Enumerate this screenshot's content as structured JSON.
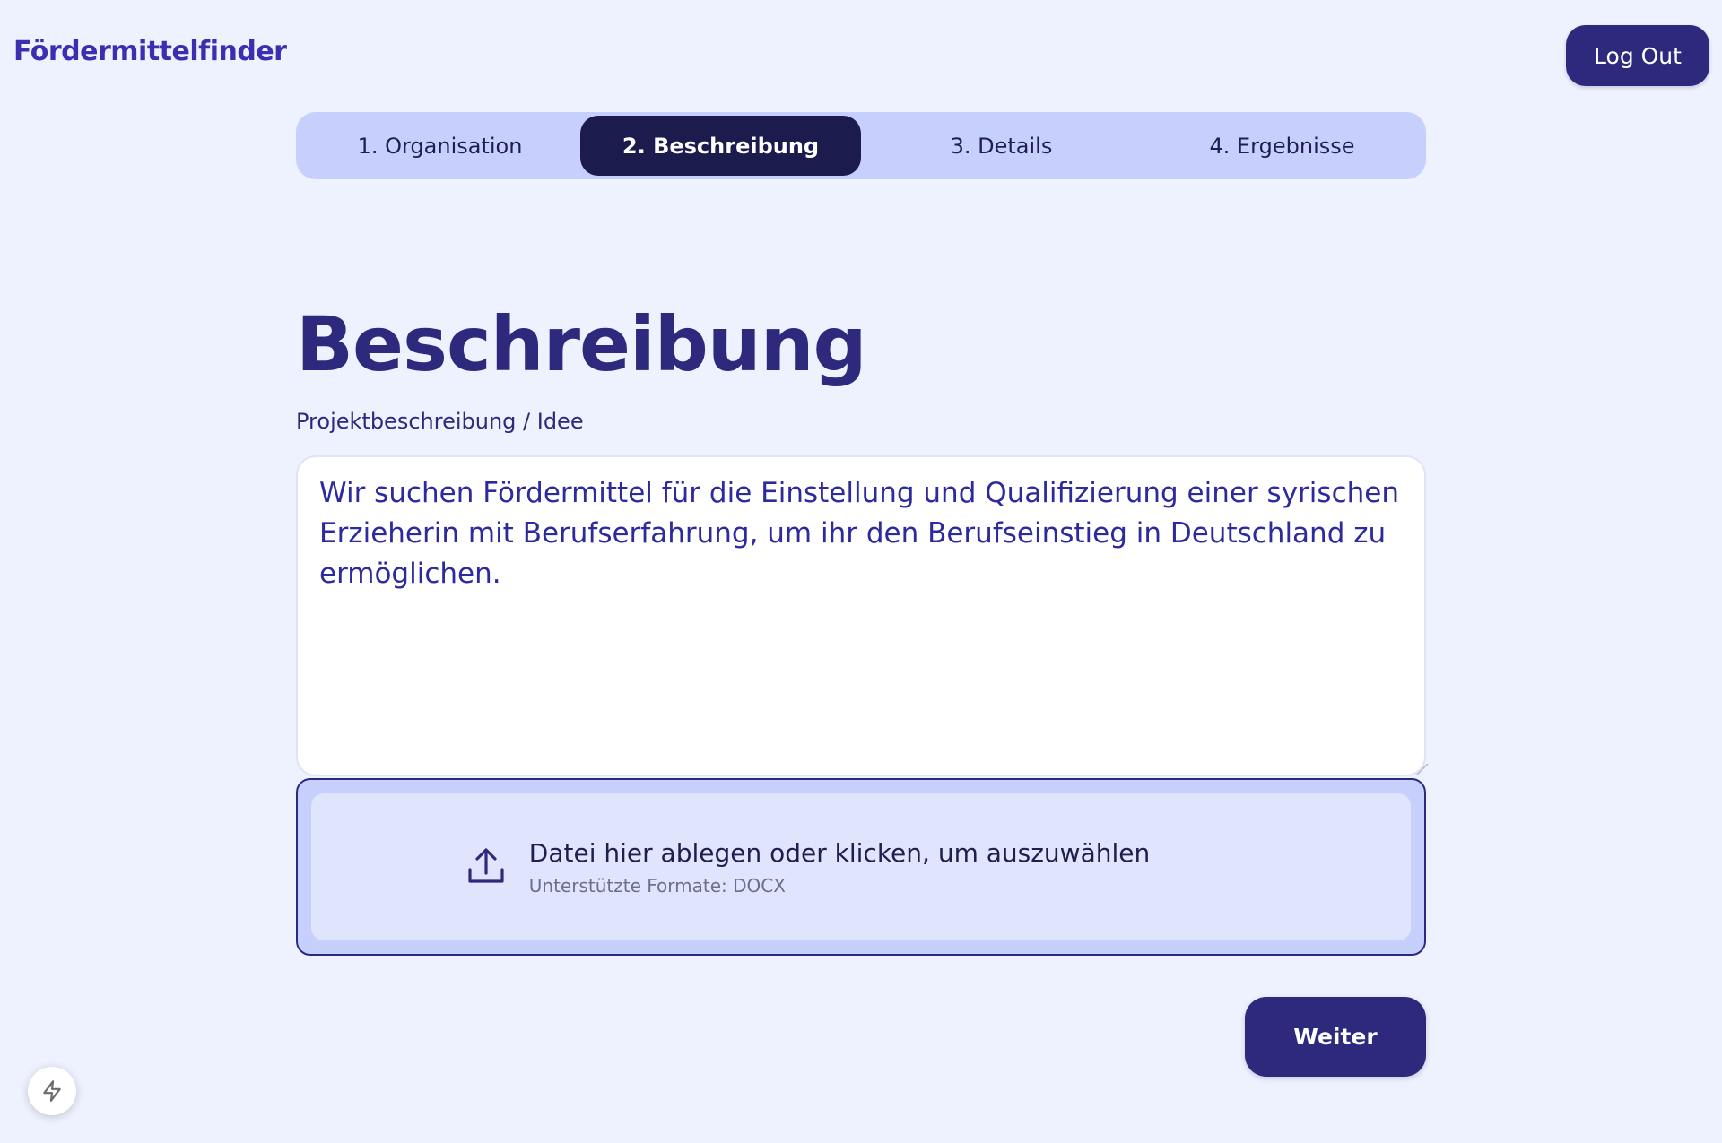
{
  "header": {
    "brand": "Fördermittelfinder",
    "logout_label": "Log Out"
  },
  "stepper": {
    "steps": [
      {
        "label": "1. Organisation",
        "active": false
      },
      {
        "label": "2. Beschreibung",
        "active": true
      },
      {
        "label": "3. Details",
        "active": false
      },
      {
        "label": "4. Ergebnisse",
        "active": false
      }
    ]
  },
  "main": {
    "title": "Beschreibung",
    "field_label": "Projektbeschreibung / Idee",
    "description_value": "Wir suchen Fördermittel für die Einstellung und Qualifizierung einer syrischen Erzieherin mit Berufserfahrung, um ihr den Berufseinstieg in Deutschland zu ermöglichen."
  },
  "dropzone": {
    "icon": "upload-icon",
    "main_text": "Datei hier ablegen oder klicken, um auszuwählen",
    "sub_text": "Unterstützte Formate: DOCX"
  },
  "actions": {
    "next_label": "Weiter"
  },
  "fab": {
    "icon": "bolt-icon"
  },
  "colors": {
    "background": "#eef1fe",
    "primary": "#2d2a7e",
    "active_step": "#1c1b4d",
    "stepper_bg": "#c7d0fd",
    "dropzone_inner": "#dfe5fd",
    "brand": "#3a2fb0"
  }
}
